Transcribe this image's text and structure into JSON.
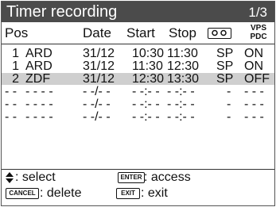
{
  "title": "Timer recording",
  "page_indicator": "1/3",
  "columns": {
    "pos": "Pos",
    "date": "Date",
    "start": "Start",
    "stop": "Stop",
    "vps_top": "VPS",
    "vps_bottom": "PDC"
  },
  "rows": [
    {
      "pos": "1",
      "station": "ARD",
      "date": "31/12",
      "start": "10:30",
      "stop": "11:30",
      "mode": "SP",
      "vps": "ON"
    },
    {
      "pos": "1",
      "station": "ARD",
      "date": "31/12",
      "start": "11:30",
      "stop": "12:30",
      "mode": "SP",
      "vps": "ON"
    },
    {
      "pos": "2",
      "station": "ZDF",
      "date": "31/12",
      "start": "12:30",
      "stop": "13:30",
      "mode": "SP",
      "vps": "OFF"
    },
    {
      "pos": "- -",
      "station": "- - - -",
      "date": "- -/- -",
      "start": "- -:- -",
      "stop": "- -:- -",
      "mode": "-",
      "vps": "- - -"
    },
    {
      "pos": "- -",
      "station": "- - - -",
      "date": "- -/- -",
      "start": "- -:- -",
      "stop": "- -:- -",
      "mode": "-",
      "vps": "- - -"
    },
    {
      "pos": "- -",
      "station": "- - - -",
      "date": "- -/- -",
      "start": "- -:- -",
      "stop": "- -:- -",
      "mode": "-",
      "vps": "- - -"
    }
  ],
  "selected_row": 3,
  "footer": {
    "select_label": ": select",
    "enter_key": "ENTER",
    "access_label": ": access",
    "cancel_key": "CANCEL",
    "delete_label": ": delete",
    "exit_key": "EXIT",
    "exit_label": ": exit"
  }
}
